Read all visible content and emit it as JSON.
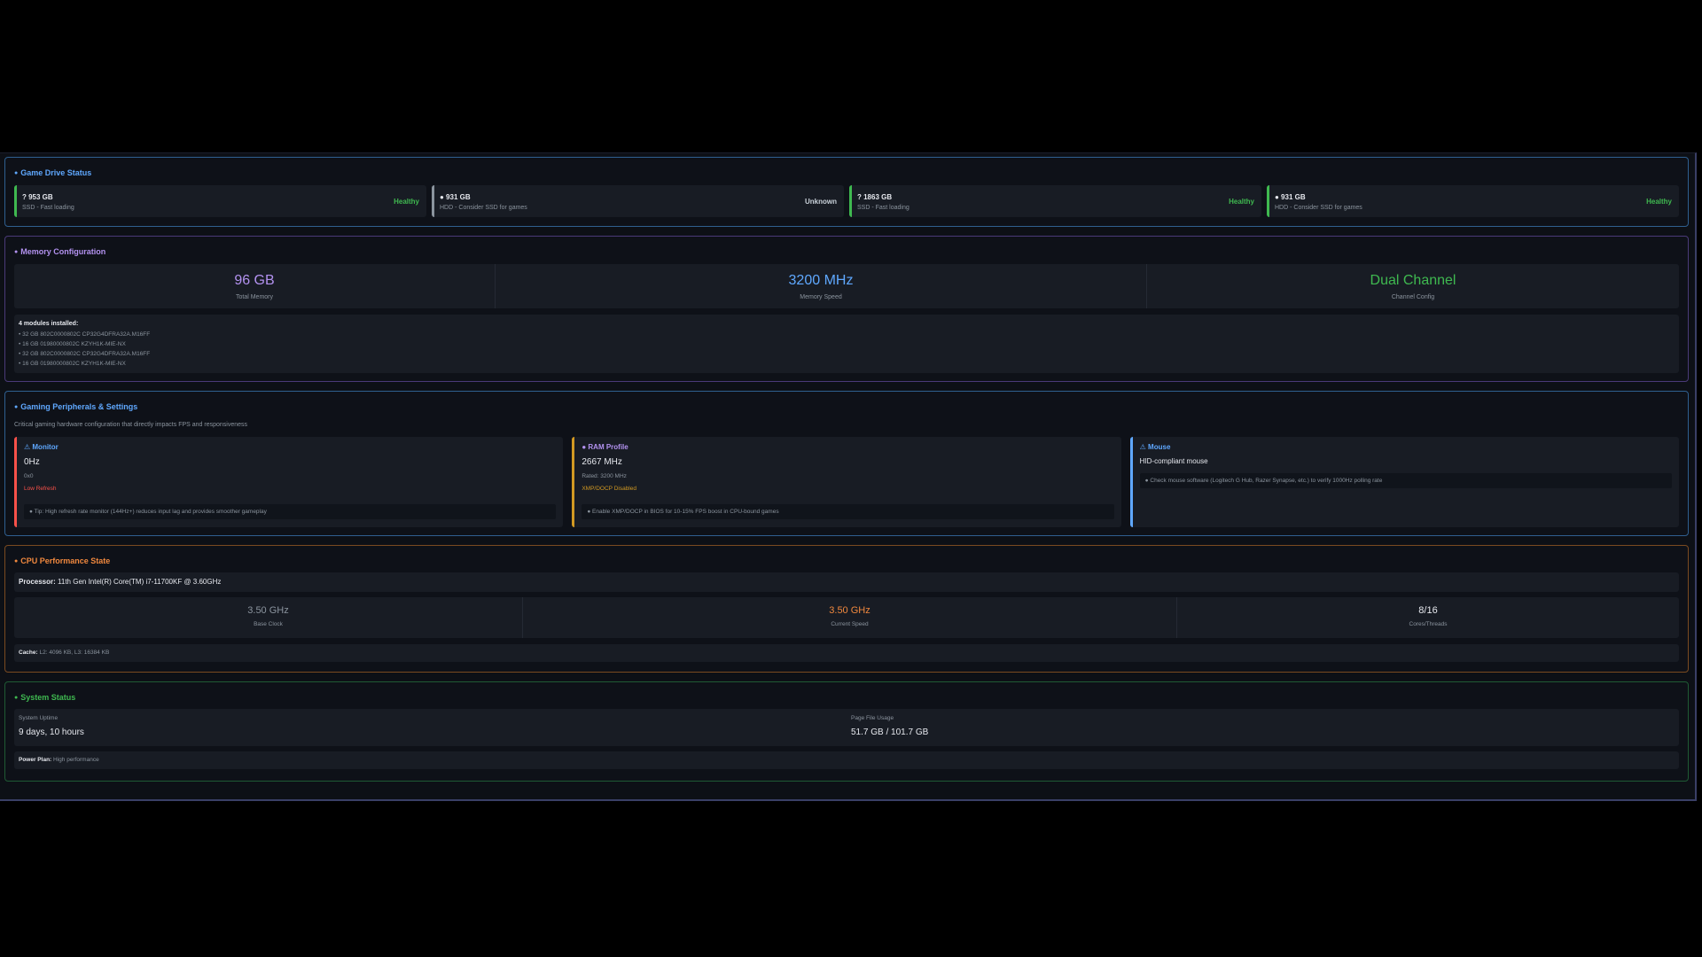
{
  "drives": {
    "title": "Game Drive Status",
    "items": [
      {
        "size": "? 953 GB",
        "type": "SSD - Fast loading",
        "status": "Healthy"
      },
      {
        "size": "● 931 GB",
        "type": "HDD - Consider SSD for games",
        "status": "Unknown"
      },
      {
        "size": "? 1863 GB",
        "type": "SSD - Fast loading",
        "status": "Healthy"
      },
      {
        "size": "● 931 GB",
        "type": "HDD - Consider SSD for games",
        "status": "Healthy"
      }
    ]
  },
  "memory": {
    "title": "Memory Configuration",
    "total": {
      "value": "96 GB",
      "label": "Total Memory"
    },
    "speed": {
      "value": "3200 MHz",
      "label": "Memory Speed"
    },
    "channel": {
      "value": "Dual Channel",
      "label": "Channel Config"
    },
    "modules_title": "4 modules installed:",
    "modules": [
      "• 32 GB 802C0000802C CP32G4DFRA32A.M16FF",
      "• 16 GB 01980000802C KZYH1K-MIE-NX",
      "• 32 GB 802C0000802C CP32G4DFRA32A.M16FF",
      "• 16 GB 01980000802C KZYH1K-MIE-NX"
    ]
  },
  "peripherals": {
    "title": "Gaming Peripherals & Settings",
    "subtitle": "Critical gaming hardware configuration that directly impacts FPS and responsiveness",
    "monitor": {
      "title": "⚠ Monitor",
      "value": "0Hz",
      "resolution": "0x0",
      "warning": "Low Refresh",
      "tip": "● Tip: High refresh rate monitor (144Hz+) reduces input lag and provides smoother gameplay"
    },
    "ram": {
      "title": "● RAM Profile",
      "value": "2667 MHz",
      "rated": "Rated: 3200 MHz",
      "warning": "XMP/DOCP Disabled",
      "tip": "● Enable XMP/DOCP in BIOS for 10-15% FPS boost in CPU-bound games"
    },
    "mouse": {
      "title": "⚠ Mouse",
      "name": "HID-compliant mouse",
      "tip": "● Check mouse software (Logitech G Hub, Razer Synapse, etc.) to verify 1000Hz polling rate"
    }
  },
  "cpu": {
    "title": "CPU Performance State",
    "processor_label": "Processor:",
    "processor": " 11th Gen Intel(R) Core(TM) i7-11700KF @ 3.60GHz",
    "base": {
      "value": "3.50 GHz",
      "label": "Base Clock"
    },
    "current": {
      "value": "3.50 GHz",
      "label": "Current Speed"
    },
    "cores": {
      "value": "8/16",
      "label": "Cores/Threads"
    },
    "cache_label": "Cache:",
    "cache": " L2: 4096 KB, L3: 16384 KB"
  },
  "system": {
    "title": "System Status",
    "uptime": {
      "label": "System Uptime",
      "value": "9 days, 10 hours"
    },
    "pagefile": {
      "label": "Page File Usage",
      "value": "51.7 GB / 101.7 GB"
    },
    "plan_label": "Power Plan:",
    "plan": " High performance"
  },
  "colors": {
    "healthy": "#3fb950",
    "info": "#5fa8ff",
    "purple": "#b392f0",
    "orange": "#f0883e",
    "danger": "#f85149",
    "warning": "#d29922"
  }
}
